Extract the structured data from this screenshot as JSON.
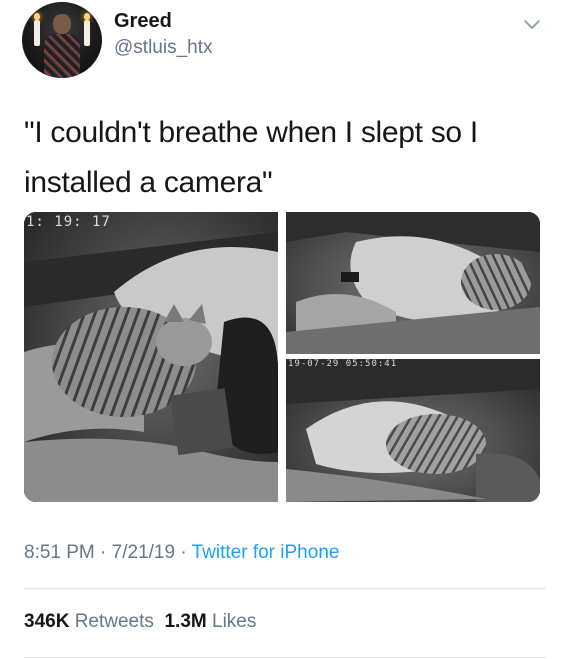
{
  "user": {
    "name": "Greed",
    "handle": "@stluis_htx"
  },
  "tweet": {
    "text_line1": "\"I couldn't breathe when I slept so I",
    "text_line2": "installed a camera\""
  },
  "media": {
    "photo1_timestamp": "1: 19: 17",
    "photo3_timestamp": "19-07-29  05:50:41"
  },
  "meta": {
    "time": "8:51 PM",
    "sep1": " · ",
    "date": "7/21/19",
    "sep2": " · ",
    "source": "Twitter for iPhone"
  },
  "stats": {
    "retweets_count": "346K",
    "retweets_label": "Retweets",
    "likes_count": "1.3M",
    "likes_label": "Likes"
  },
  "colors": {
    "text": "#14171a",
    "secondary": "#657786",
    "link": "#1da1f2",
    "divider": "#e1e8ed"
  }
}
